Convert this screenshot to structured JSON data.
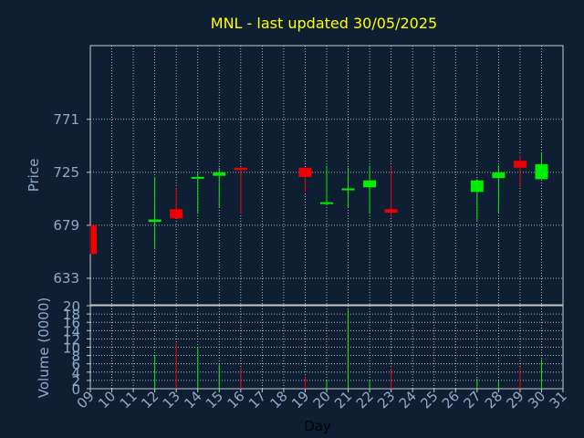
{
  "chart_data": {
    "type": "candlestick",
    "title": "MNL - last updated 30/05/2025",
    "xlabel": "Day",
    "price_panel": {
      "ylabel": "Price",
      "ylim": [
        610,
        835
      ],
      "yticks": [
        633,
        679,
        725,
        771
      ]
    },
    "volume_panel": {
      "ylabel": "Volume (0000)",
      "ylim": [
        0,
        20
      ],
      "yticks": [
        0,
        2,
        4,
        6,
        8,
        10,
        12,
        14,
        16,
        18,
        20
      ]
    },
    "x_range": [
      9,
      31
    ],
    "x_tick_labels": [
      "09",
      "10",
      "11",
      "12",
      "13",
      "14",
      "15",
      "16",
      "17",
      "18",
      "19",
      "20",
      "21",
      "22",
      "23",
      "24",
      "25",
      "26",
      "27",
      "28",
      "29",
      "30",
      "31"
    ],
    "grid": true,
    "colors": {
      "background": "#0f1f33",
      "axis_text": "#8eaacb",
      "title": "#ffff00",
      "up": "#00ee00",
      "down": "#ee0000",
      "grid": "#ffffff"
    },
    "candles": [
      {
        "day": 9,
        "open": 679,
        "close": 654,
        "high": 679,
        "low": 654,
        "volume": 0
      },
      {
        "day": 12,
        "open": 682,
        "close": 684,
        "high": 721,
        "low": 658,
        "volume": 8
      },
      {
        "day": 13,
        "open": 693,
        "close": 685,
        "high": 711,
        "low": 685,
        "volume": 11
      },
      {
        "day": 14,
        "open": 720,
        "close": 721,
        "high": 725,
        "low": 689,
        "volume": 10
      },
      {
        "day": 15,
        "open": 722,
        "close": 725,
        "high": 729,
        "low": 694,
        "volume": 6
      },
      {
        "day": 16,
        "open": 729,
        "close": 727,
        "high": 729,
        "low": 689,
        "volume": 5
      },
      {
        "day": 19,
        "open": 729,
        "close": 721,
        "high": 729,
        "low": 708,
        "volume": 3
      },
      {
        "day": 20,
        "open": 698,
        "close": 699,
        "high": 731,
        "low": 697,
        "volume": 2
      },
      {
        "day": 21,
        "open": 710,
        "close": 711,
        "high": 729,
        "low": 694,
        "volume": 19
      },
      {
        "day": 22,
        "open": 712,
        "close": 718,
        "high": 731,
        "low": 689,
        "volume": 2
      },
      {
        "day": 23,
        "open": 693,
        "close": 690,
        "high": 730,
        "low": 686,
        "volume": 5
      },
      {
        "day": 27,
        "open": 708,
        "close": 718,
        "high": 719,
        "low": 683,
        "volume": 2.5
      },
      {
        "day": 28,
        "open": 720,
        "close": 725,
        "high": 731,
        "low": 690,
        "volume": 2
      },
      {
        "day": 29,
        "open": 735,
        "close": 729,
        "high": 740,
        "low": 712,
        "volume": 5
      },
      {
        "day": 30,
        "open": 719,
        "close": 732,
        "high": 742,
        "low": 719,
        "volume": 7
      }
    ]
  }
}
